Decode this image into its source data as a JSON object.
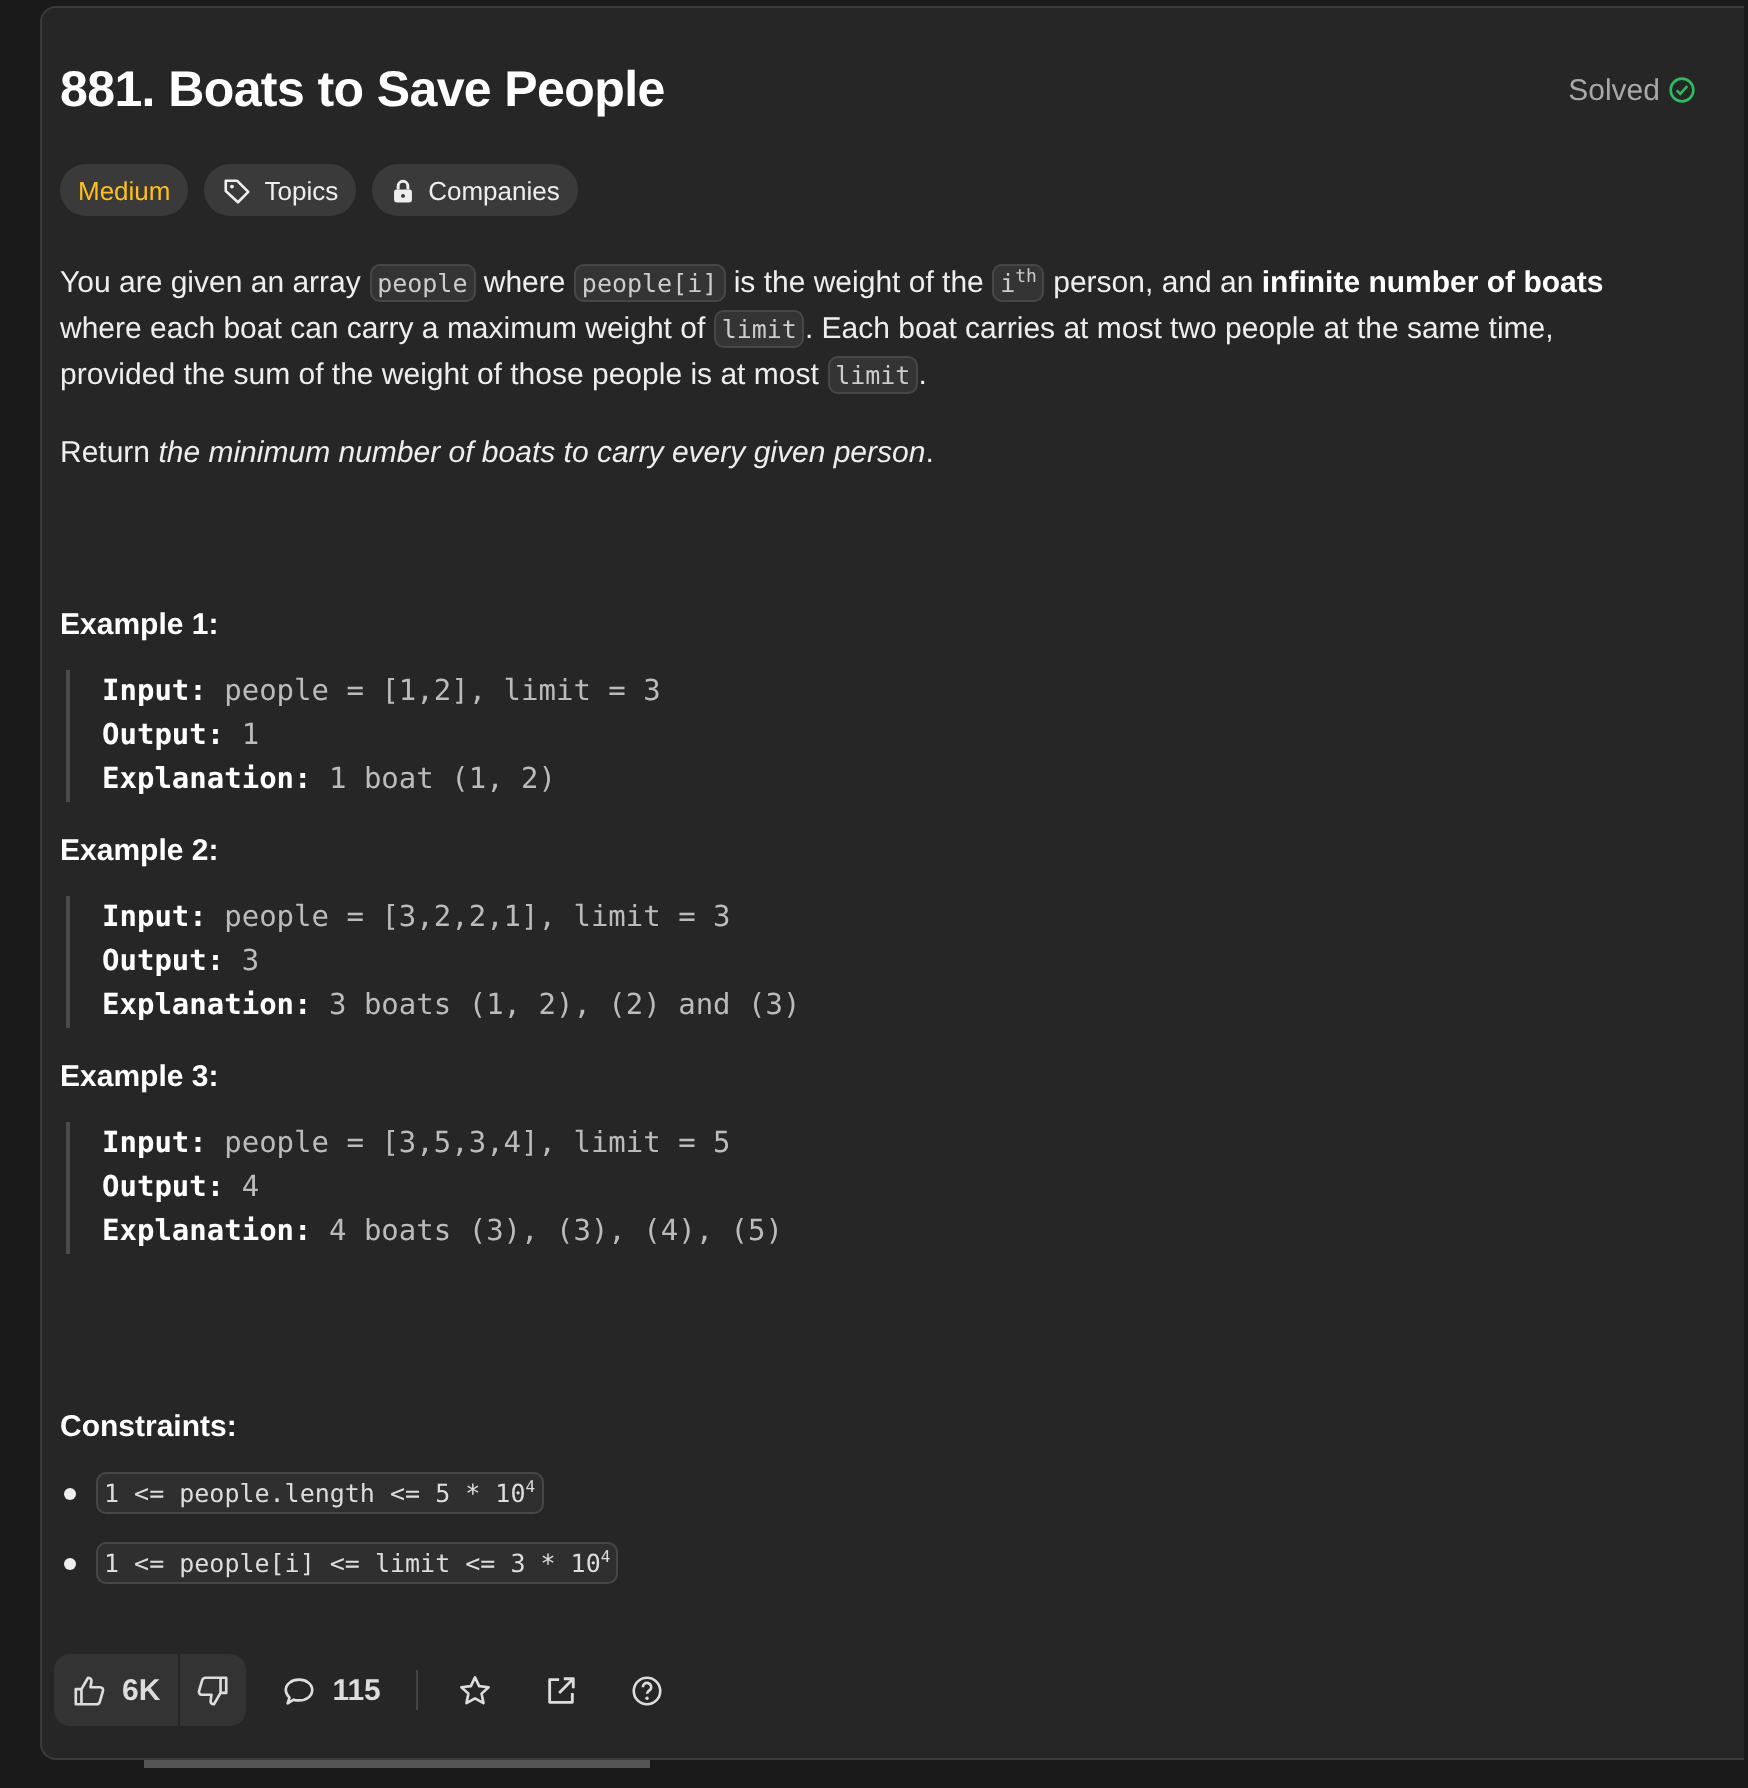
{
  "problem": {
    "title": "881. Boats to Save People",
    "status": "Solved",
    "solved": true
  },
  "tags": [
    {
      "kind": "difficulty",
      "label": "Medium"
    },
    {
      "kind": "topics",
      "label": "Topics"
    },
    {
      "kind": "companies",
      "label": "Companies"
    }
  ],
  "description": [
    [
      {
        "kind": "text",
        "text": "You are given an array "
      },
      {
        "kind": "code",
        "text": "people"
      },
      {
        "kind": "text",
        "text": " where "
      },
      {
        "kind": "code",
        "text": "people[i]"
      },
      {
        "kind": "text",
        "text": " is the weight of the "
      },
      {
        "kind": "code",
        "text": "i$^{th}$"
      },
      {
        "kind": "text",
        "text": " person, and an **infinite number of boats** where each boat can carry a maximum weight of "
      },
      {
        "kind": "code",
        "text": "limit"
      },
      {
        "kind": "text",
        "text": ". Each boat carries at most two people at the same time, provided the sum of the weight of those people is at most "
      },
      {
        "kind": "code",
        "text": "limit"
      },
      {
        "kind": "text",
        "text": "."
      }
    ],
    [
      {
        "kind": "text",
        "text": "Return *the minimum number of boats to carry every given person*."
      }
    ]
  ],
  "examples": [
    {
      "heading": "Example 1:",
      "lines": [
        "**Input:** people = [1,2], limit = 3",
        "**Output:** 1",
        "**Explanation:** 1 boat (1, 2)"
      ]
    },
    {
      "heading": "Example 2:",
      "lines": [
        "**Input:** people = [3,2,2,1], limit = 3",
        "**Output:** 3",
        "**Explanation:** 3 boats (1, 2), (2) and (3)"
      ]
    },
    {
      "heading": "Example 3:",
      "lines": [
        "**Input:** people = [3,5,3,4], limit = 5",
        "**Output:** 4",
        "**Explanation:** 4 boats (3), (3), (4), (5)"
      ]
    }
  ],
  "constraints": {
    "heading": "Constraints:",
    "items": [
      "1 <= people.length <= 5 * 10$^{4}$",
      "1 <= people[i] <= limit <= 3 * 10$^{4}$"
    ]
  },
  "footer": {
    "likes": "6K",
    "comments": "115"
  }
}
